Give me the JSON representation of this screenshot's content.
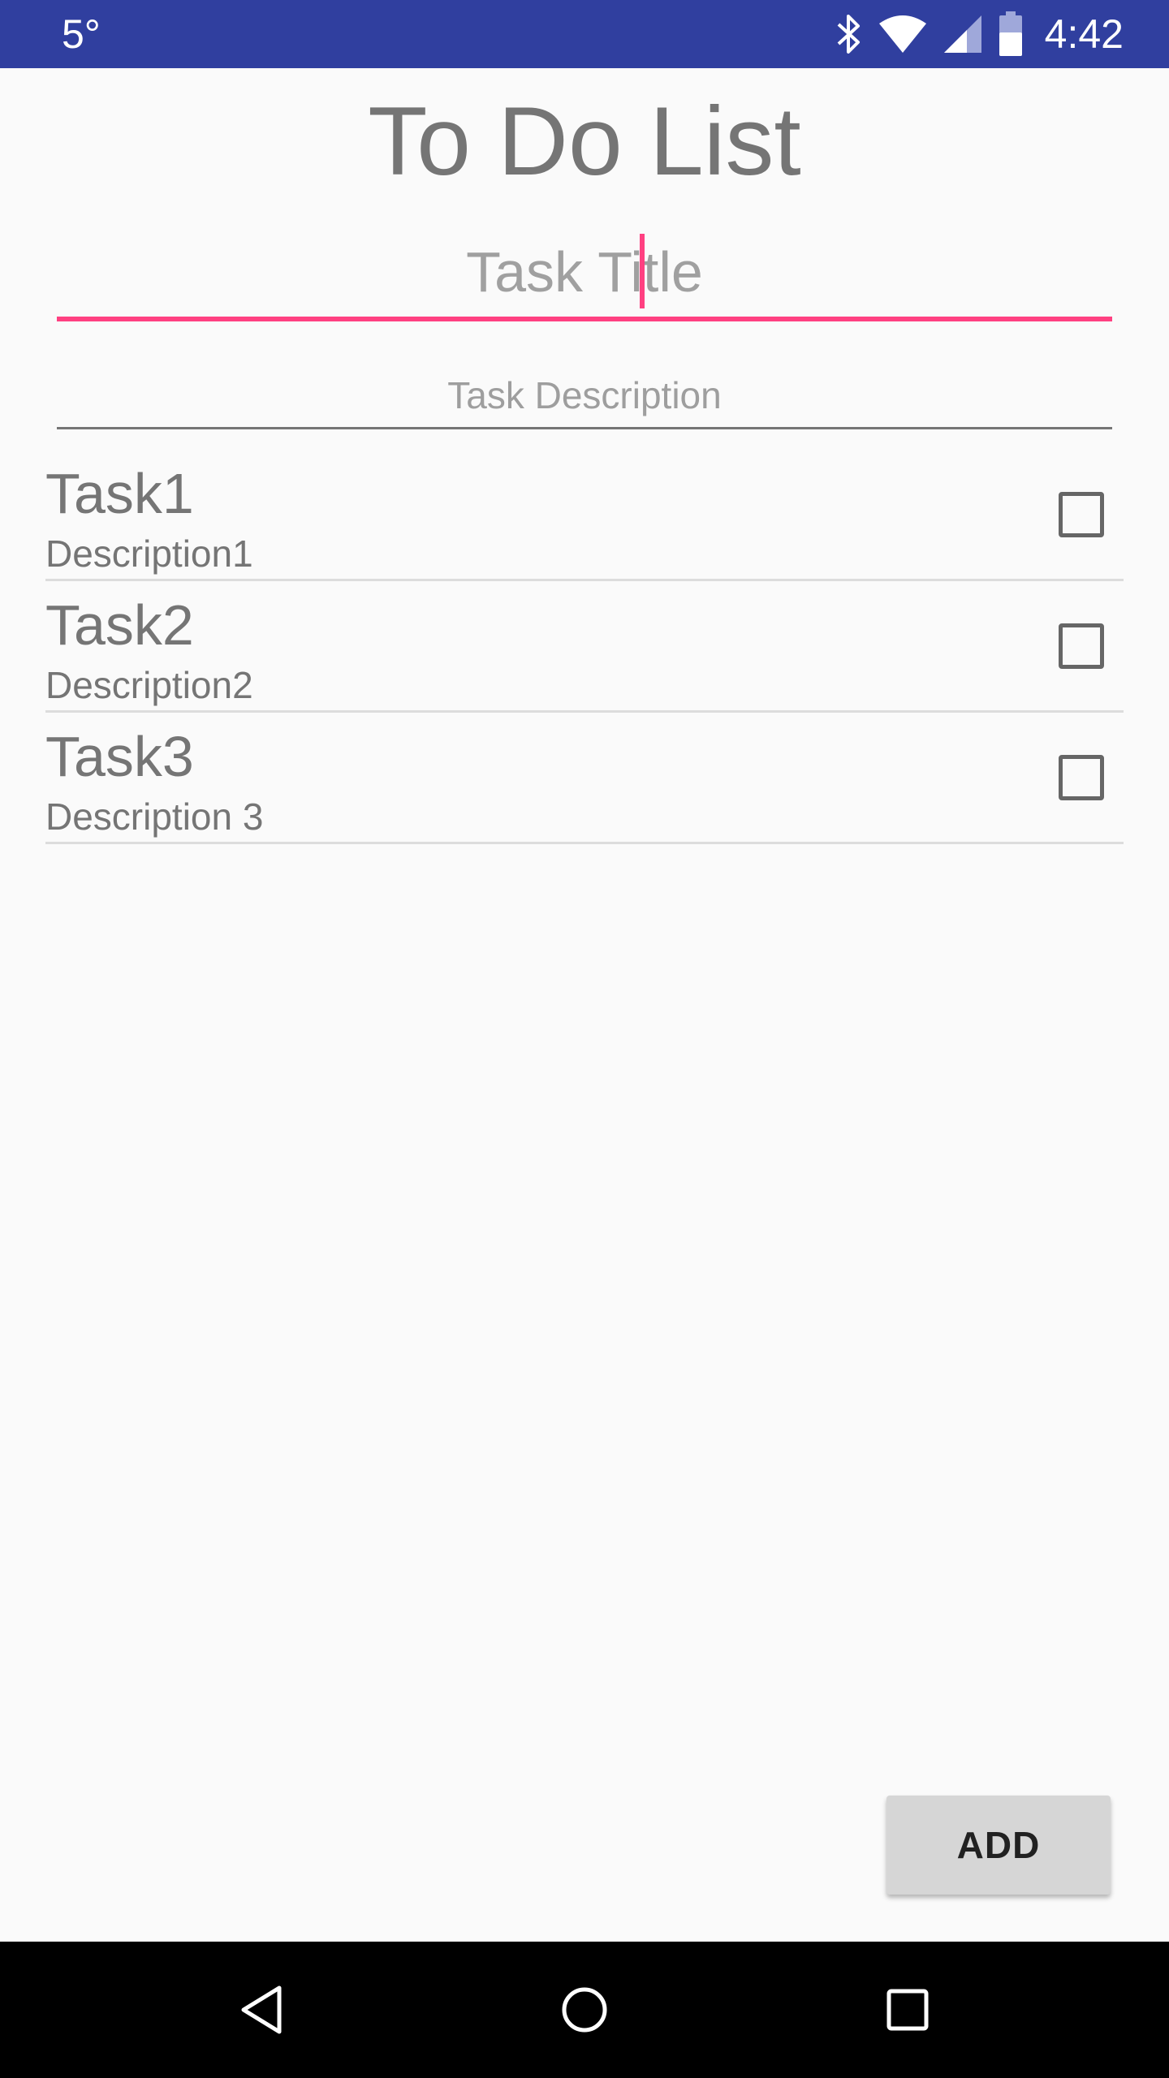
{
  "status_bar": {
    "temperature": "5°",
    "time": "4:42",
    "icons": [
      "bluetooth-icon",
      "wifi-icon",
      "signal-icon",
      "battery-icon"
    ],
    "background_color": "#303f9f"
  },
  "app": {
    "title": "To Do List"
  },
  "form": {
    "title_placeholder": "Task Title",
    "title_value": "",
    "description_placeholder": "Task Description",
    "description_value": "",
    "accent_color": "#ff4081"
  },
  "tasks": [
    {
      "title": "Task1",
      "description": "Description1",
      "checked": false
    },
    {
      "title": "Task2",
      "description": "Description2",
      "checked": false
    },
    {
      "title": "Task3",
      "description": "Description 3",
      "checked": false
    }
  ],
  "add_button": {
    "label": "ADD"
  },
  "nav_bar": {
    "icons": [
      "back-icon",
      "home-icon",
      "recents-icon"
    ]
  }
}
